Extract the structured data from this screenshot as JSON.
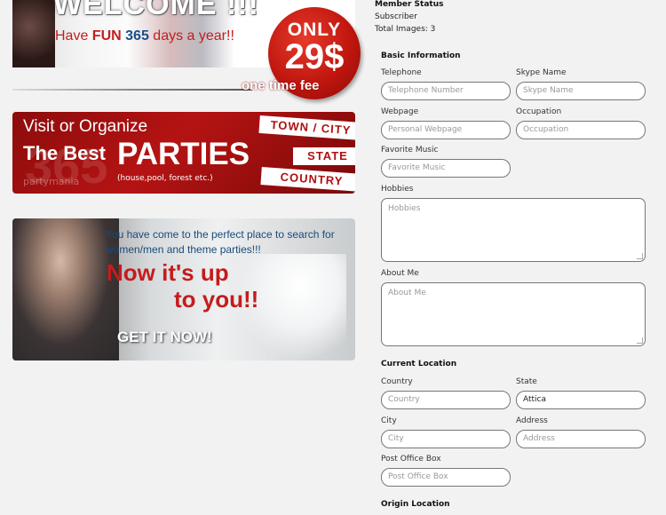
{
  "banners": {
    "welcome": {
      "title": "WELCOME !!!",
      "tagline_prefix": "Have ",
      "tagline_fun": "FUN",
      "tagline_number": "365",
      "tagline_suffix": " days a year!!",
      "badge_only": "ONLY",
      "badge_price": "29$",
      "fee": "one time fee"
    },
    "parties": {
      "visit": "Visit or Organize",
      "best": "The Best",
      "parties": "PARTIES",
      "sub": "(house,pool, forest etc.)",
      "brand": "partymania",
      "tags": [
        "TOWN / CITY",
        "STATE",
        "COUNTRY"
      ]
    },
    "upto": {
      "come": "You have come to the perfect place to search for women/men and theme parties!!!",
      "line1": "Now it's up",
      "line2": "to you!!",
      "cta": "GET IT NOW!"
    }
  },
  "member": {
    "status_title": "Member Status",
    "status": "Subscriber",
    "total_images": "Total Images: 3"
  },
  "basic": {
    "title": "Basic Information",
    "telephone": {
      "label": "Telephone",
      "placeholder": "Telephone Number",
      "value": ""
    },
    "skype": {
      "label": "Skype Name",
      "placeholder": "Skype Name",
      "value": ""
    },
    "webpage": {
      "label": "Webpage",
      "placeholder": "Personal Webpage",
      "value": ""
    },
    "occupation": {
      "label": "Occupation",
      "placeholder": "Occupation",
      "value": ""
    },
    "music": {
      "label": "Favorite Music",
      "placeholder": "Favorite Music",
      "value": ""
    },
    "hobbies": {
      "label": "Hobbies",
      "placeholder": "Hobbies",
      "value": ""
    },
    "about": {
      "label": "About Me",
      "placeholder": "About Me",
      "value": ""
    }
  },
  "location": {
    "title": "Current Location",
    "country": {
      "label": "Country",
      "placeholder": "Country",
      "value": ""
    },
    "state": {
      "label": "State",
      "placeholder": "State",
      "value": "Attica"
    },
    "city": {
      "label": "City",
      "placeholder": "City",
      "value": ""
    },
    "address": {
      "label": "Address",
      "placeholder": "Address",
      "value": ""
    },
    "pobox": {
      "label": "Post Office Box",
      "placeholder": "Post Office Box",
      "value": ""
    }
  },
  "origin": {
    "title": "Origin Location"
  }
}
